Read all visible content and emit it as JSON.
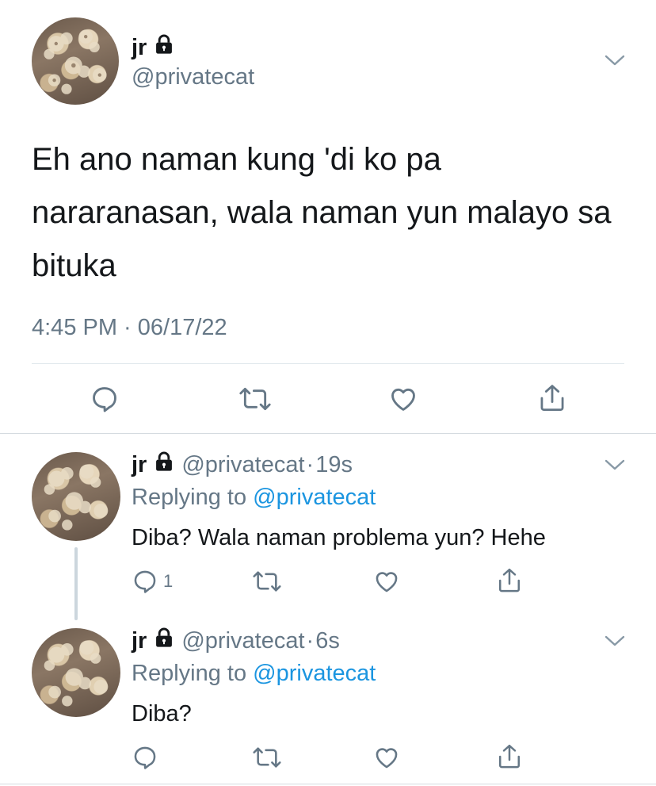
{
  "main_tweet": {
    "name": "jr",
    "handle": "@privatecat",
    "text": "Eh ano naman kung 'di ko pa nararanasan, wala naman yun malayo sa bituka",
    "timestamp": "4:45 PM · 06/17/22",
    "icons": [
      "lock-icon",
      "chevron-down-icon",
      "reply-icon",
      "retweet-icon",
      "like-icon",
      "share-icon"
    ]
  },
  "replies": [
    {
      "name": "jr",
      "handle": "@privatecat",
      "time": "19s",
      "replying_prefix": "Replying to",
      "replying_mention": "@privatecat",
      "text": "Diba? Wala naman problema yun? Hehe",
      "reply_count": "1"
    },
    {
      "name": "jr",
      "handle": "@privatecat",
      "time": "6s",
      "replying_prefix": "Replying to",
      "replying_mention": "@privatecat",
      "text": "Diba?",
      "reply_count": ""
    }
  ],
  "colors": {
    "text": "#14171a",
    "secondary": "#657786",
    "link": "#1b95e0",
    "divider": "#e1e8ed"
  }
}
